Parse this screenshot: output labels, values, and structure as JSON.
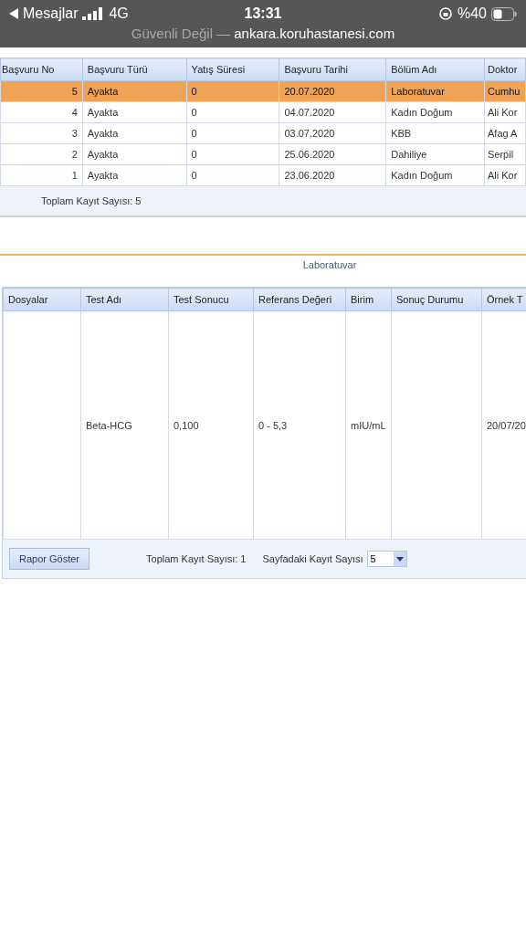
{
  "status_bar": {
    "back_label": "Mesajlar",
    "network": "4G",
    "time": "13:31",
    "battery": "%40"
  },
  "address_bar": {
    "security": "Güvenli Değil",
    "separator": "—",
    "domain": "ankara.koruhastanesi.com"
  },
  "applications_table": {
    "columns": [
      "Başvuru No",
      "Başvuru Türü",
      "Yatış Süresi",
      "Başvuru Tarihi",
      "Bölüm Adı",
      "Doktor"
    ],
    "rows": [
      {
        "cells": [
          "5",
          "Ayakta",
          "0",
          "20.07.2020",
          "Laboratuvar",
          "Cumhu"
        ],
        "selected": true
      },
      {
        "cells": [
          "4",
          "Ayakta",
          "0",
          "04.07.2020",
          "Kadın Doğum",
          "Ali Kor"
        ],
        "selected": false
      },
      {
        "cells": [
          "3",
          "Ayakta",
          "0",
          "03.07.2020",
          "KBB",
          "Afag A"
        ],
        "selected": false
      },
      {
        "cells": [
          "2",
          "Ayakta",
          "0",
          "25.06.2020",
          "Dahiliye",
          "Serpil"
        ],
        "selected": false
      },
      {
        "cells": [
          "1",
          "Ayakta",
          "0",
          "23.06.2020",
          "Kadın Doğum",
          "Ali Kor"
        ],
        "selected": false
      }
    ],
    "footer": "Toplam Kayıt Sayısı: 5"
  },
  "section_title": "Laboratuvar",
  "results_table": {
    "columns": [
      "Dosyalar",
      "Test Adı",
      "Test Sonucu",
      "Referans Değeri",
      "Birim",
      "Sonuç Durumu",
      "Örnek T"
    ],
    "rows": [
      {
        "cells": [
          "",
          "Beta-HCG",
          "0,100",
          "0 - 5,3",
          "mIU/mL",
          "",
          "20/07/20"
        ]
      }
    ],
    "report_button": "Rapor Göster",
    "total": "Toplam Kayıt Sayısı: 1",
    "page_size_label": "Sayfadaki Kayıt Sayısı",
    "page_size": "5"
  }
}
